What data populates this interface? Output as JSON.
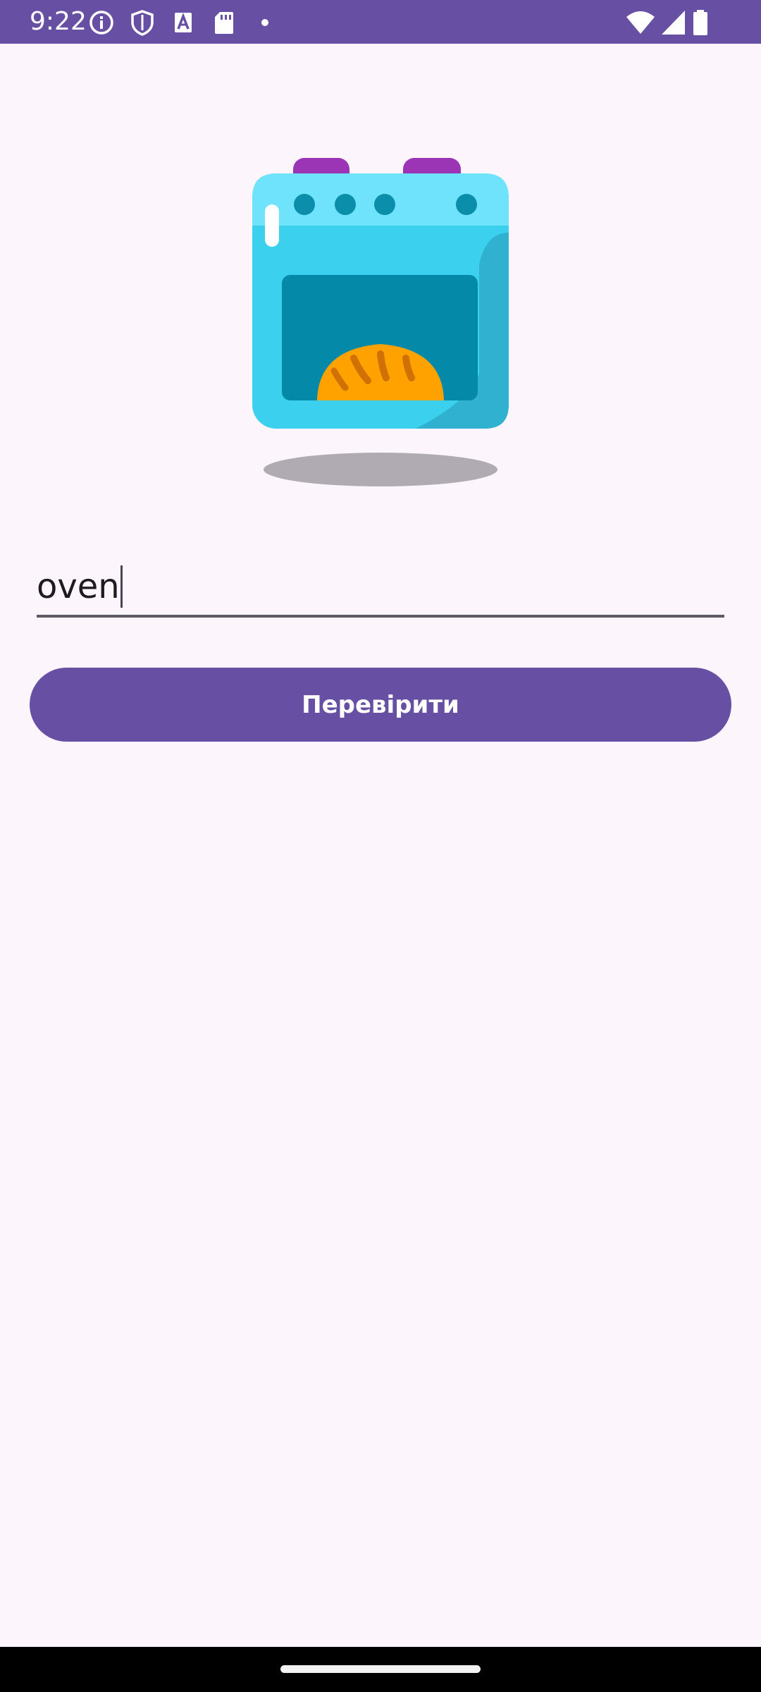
{
  "status_bar": {
    "time": "9:22",
    "left_icons": [
      "info-icon",
      "shield-icon",
      "text-a-icon",
      "sd-card-icon",
      "dot-icon"
    ],
    "right_icons": [
      "wifi-icon",
      "cell-signal-icon",
      "battery-icon"
    ],
    "background": "#6750a4"
  },
  "illustration": {
    "icon": "oven-icon"
  },
  "input": {
    "value": "oven"
  },
  "check_button": {
    "label": "Перевірити",
    "color": "#6750a4"
  },
  "nav_bar": {
    "handle": "home-handle"
  },
  "colors": {
    "background": "#fcf5fc",
    "accent": "#6750a4"
  }
}
